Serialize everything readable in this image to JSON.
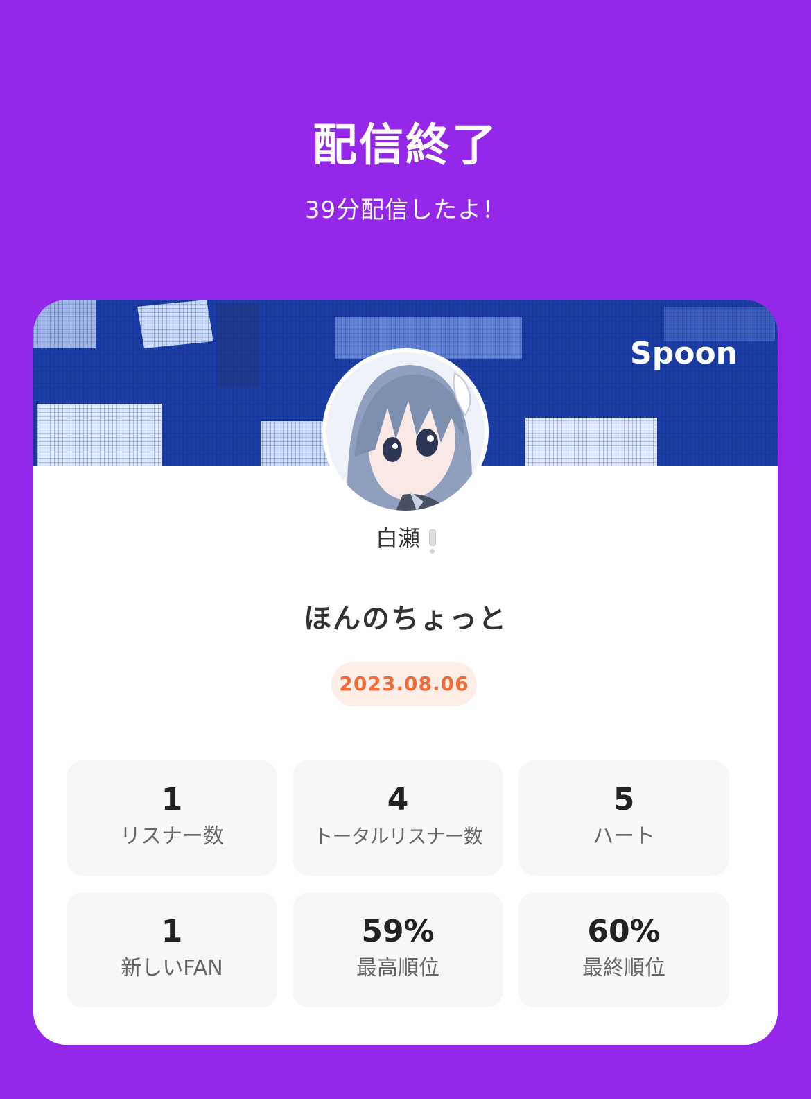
{
  "header": {
    "title": "配信終了",
    "subtitle": "39分配信したよ！"
  },
  "card": {
    "brand": "Spoon",
    "avatar": "avatar-image",
    "username": "白瀬",
    "broadcast_title": "ほんのちょっと",
    "date": "2023.08.06"
  },
  "stats": [
    {
      "value": "1",
      "label": "リスナー数"
    },
    {
      "value": "4",
      "label": "トータルリスナー数"
    },
    {
      "value": "5",
      "label": "ハート"
    },
    {
      "value": "1",
      "label": "新しいFAN"
    },
    {
      "value": "59%",
      "label": "最高順位"
    },
    {
      "value": "60%",
      "label": "最終順位"
    }
  ],
  "colors": {
    "background": "#9427e8",
    "card": "#ffffff",
    "date_text": "#f06a3a",
    "date_badge": "#fdeee8",
    "stat_tile": "#f7f7f7"
  }
}
